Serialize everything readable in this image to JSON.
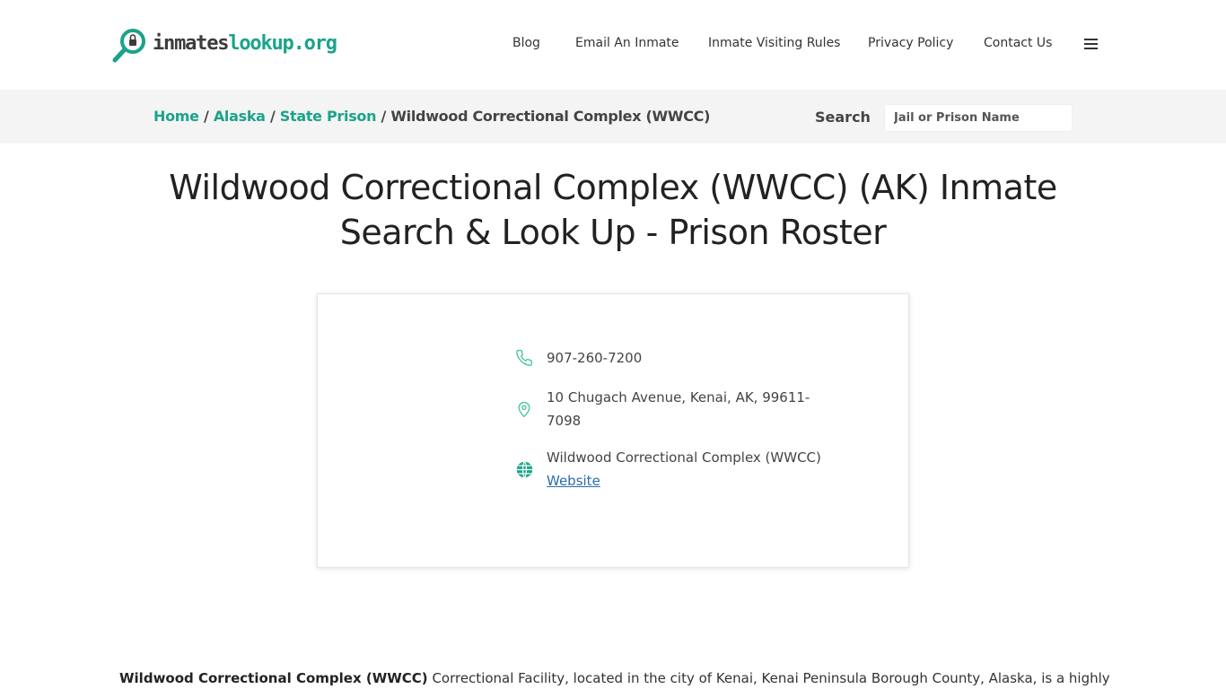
{
  "header": {
    "logo_part1": "inmates",
    "logo_part2": "lookup.org",
    "nav": [
      "Blog",
      "Email An Inmate",
      "Inmate Visiting Rules",
      "Privacy Policy",
      "Contact Us"
    ],
    "menu_icon": "hamburger-icon"
  },
  "breadcrumb": {
    "home": "Home",
    "state": "Alaska",
    "category": "State Prison",
    "current": "Wildwood Correctional Complex (WWCC)",
    "separator": "/"
  },
  "search": {
    "label": "Search",
    "placeholder": "Jail or Prison Name"
  },
  "page": {
    "title": "Wildwood Correctional Complex (WWCC) (AK) Inmate Search & Look Up - Prison Roster"
  },
  "card": {
    "phone": "907-260-7200",
    "address": "10 Chugach Avenue, Kenai, AK, 99611-7098",
    "facility_name": "Wildwood Correctional Complex (WWCC)",
    "website_label": "Website",
    "icons": [
      "phone-icon",
      "location-pin-icon",
      "globe-icon"
    ]
  },
  "intro": {
    "bold": "Wildwood Correctional Complex (WWCC)",
    "text": " Correctional Facility, located in the city of Kenai, Kenai Peninsula Borough County, Alaska, is a highly"
  },
  "colors": {
    "accent": "#1ba38a",
    "link": "#2b6cb0",
    "crumb_bg": "#f4f4f4"
  }
}
